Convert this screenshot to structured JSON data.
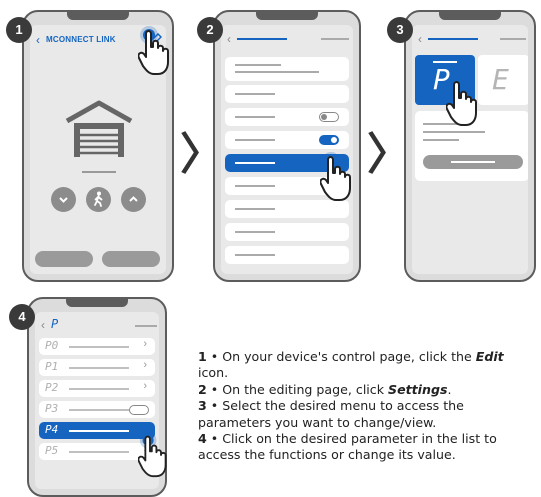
{
  "steps": [
    {
      "number": "1",
      "screen_title": "MCONNECT LINK"
    },
    {
      "number": "2"
    },
    {
      "number": "3",
      "param_letter": "P",
      "param_value": "E"
    },
    {
      "number": "4",
      "header_letter": "P",
      "params": [
        "P0",
        "P1",
        "P2",
        "P3",
        "P4",
        "P5"
      ],
      "selected_param": "P4"
    }
  ],
  "instructions": [
    {
      "num": "1",
      "sep": " • ",
      "before": "On your device's control page, click the ",
      "emph": "Edit",
      "after": " icon."
    },
    {
      "num": "2",
      "sep": " • ",
      "before": "On the editing page, click ",
      "emph": "Settings",
      "after": "."
    },
    {
      "num": "3",
      "sep": " • ",
      "before": "Select the desired menu to access the parameters you want to change/view.",
      "emph": "",
      "after": ""
    },
    {
      "num": "4",
      "sep": " • ",
      "before": "Click on the desired parameter in the list to access the functions or change its value.",
      "emph": "",
      "after": ""
    }
  ],
  "colors": {
    "accent": "#1565c0",
    "badge": "#3a3a3a",
    "frame": "#5c5c5c"
  },
  "icons": [
    "back-arrow-icon",
    "edit-pencil-icon",
    "garage-icon",
    "chevron-down-icon",
    "pedestrian-icon",
    "chevron-up-icon",
    "hand-pointer-icon",
    "chevron-right-icon"
  ]
}
